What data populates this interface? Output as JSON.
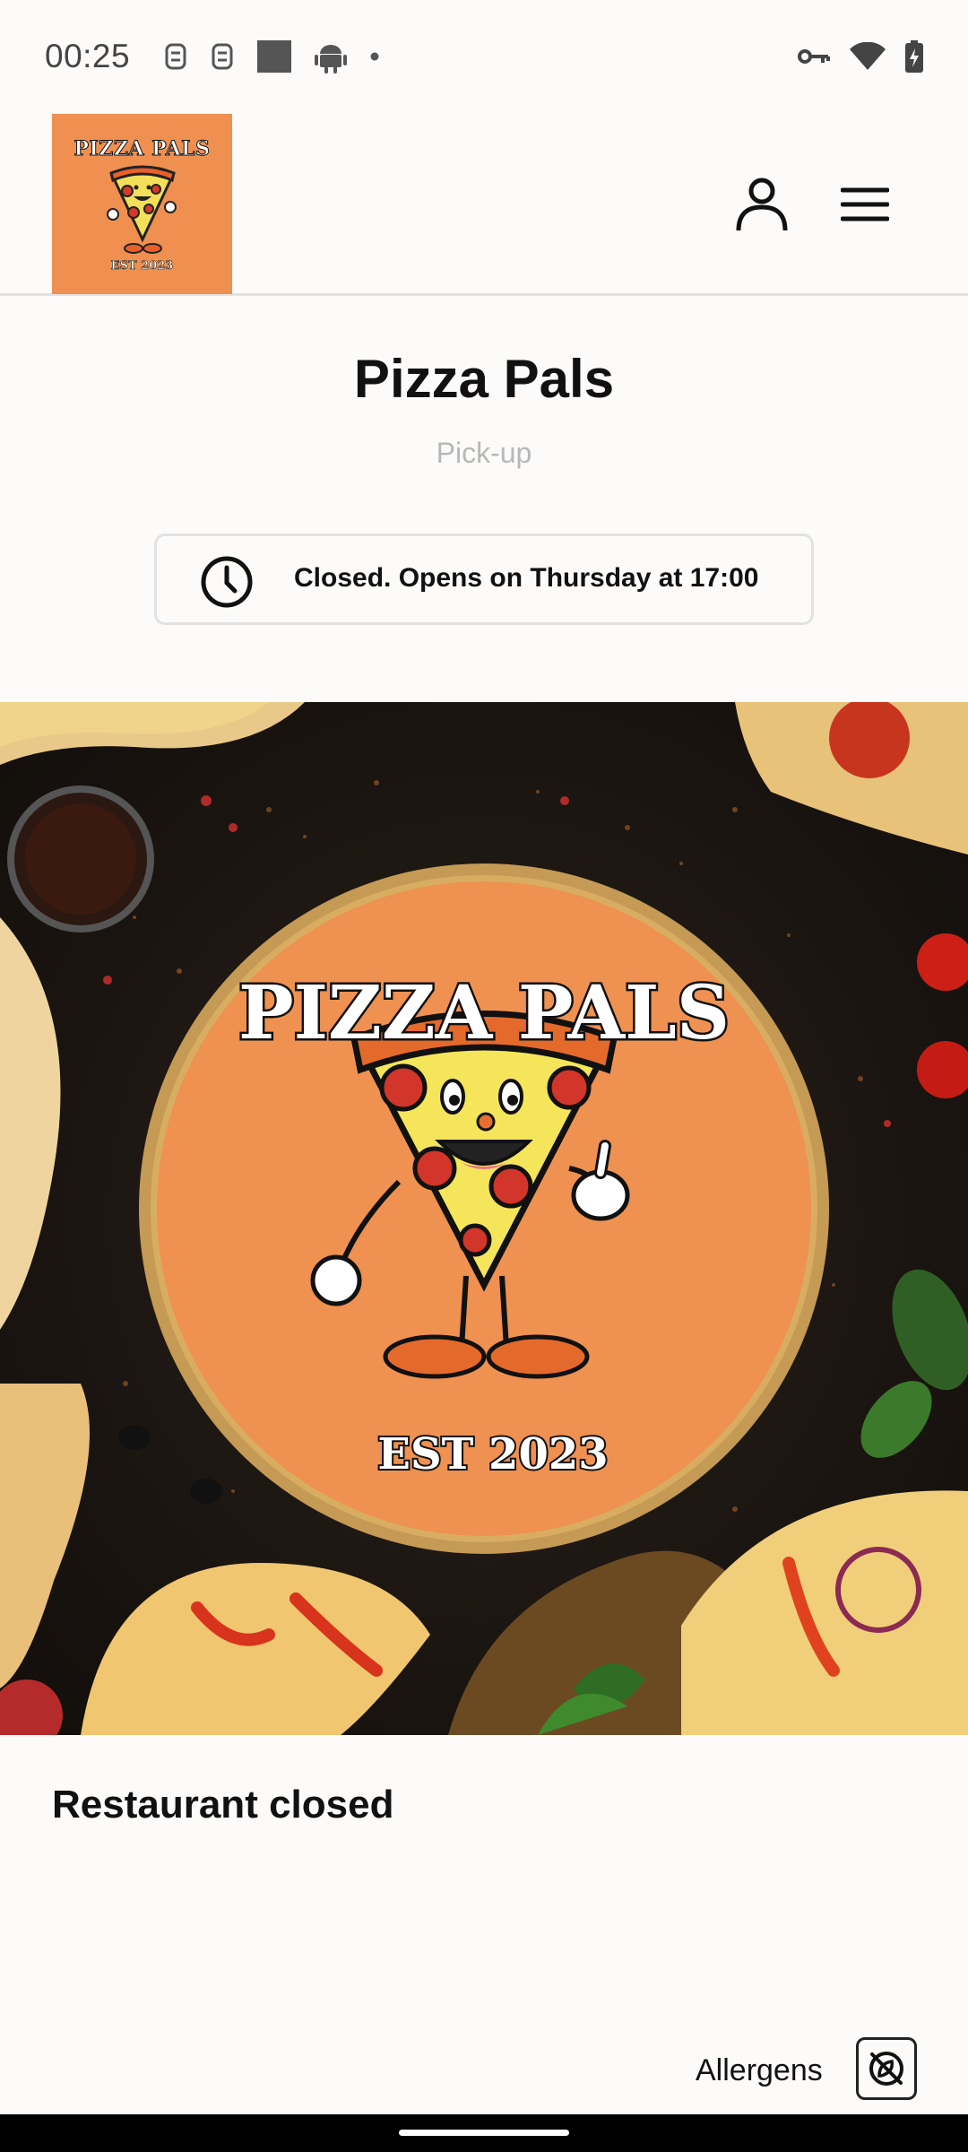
{
  "status_bar": {
    "time": "00:25",
    "left_icons": [
      "sim-card-icon",
      "sim-card-icon",
      "gallery-icon",
      "android-icon",
      "dot-icon"
    ],
    "right_icons": [
      "vpn-key-icon",
      "wifi-icon",
      "battery-charging-icon"
    ]
  },
  "header": {
    "logo": {
      "title": "PIZZA PALS",
      "est": "EST 2023"
    },
    "account_icon": "person-icon",
    "menu_icon": "hamburger-menu-icon"
  },
  "restaurant": {
    "name": "Pizza Pals",
    "order_mode": "Pick-up",
    "hours_status": "Closed. Opens on Thursday at 17:00"
  },
  "hero": {
    "logo_title": "PIZZA PALS",
    "logo_est": "EST 2023"
  },
  "status_heading": "Restaurant closed",
  "allergens": {
    "label": "Allergens",
    "icon": "no-allergen-icon"
  },
  "colors": {
    "brand_orange": "#ef9050",
    "text_primary": "#111111",
    "text_muted": "#b8b8b8",
    "border": "#e2e2e2",
    "background": "#fcfbfa"
  }
}
